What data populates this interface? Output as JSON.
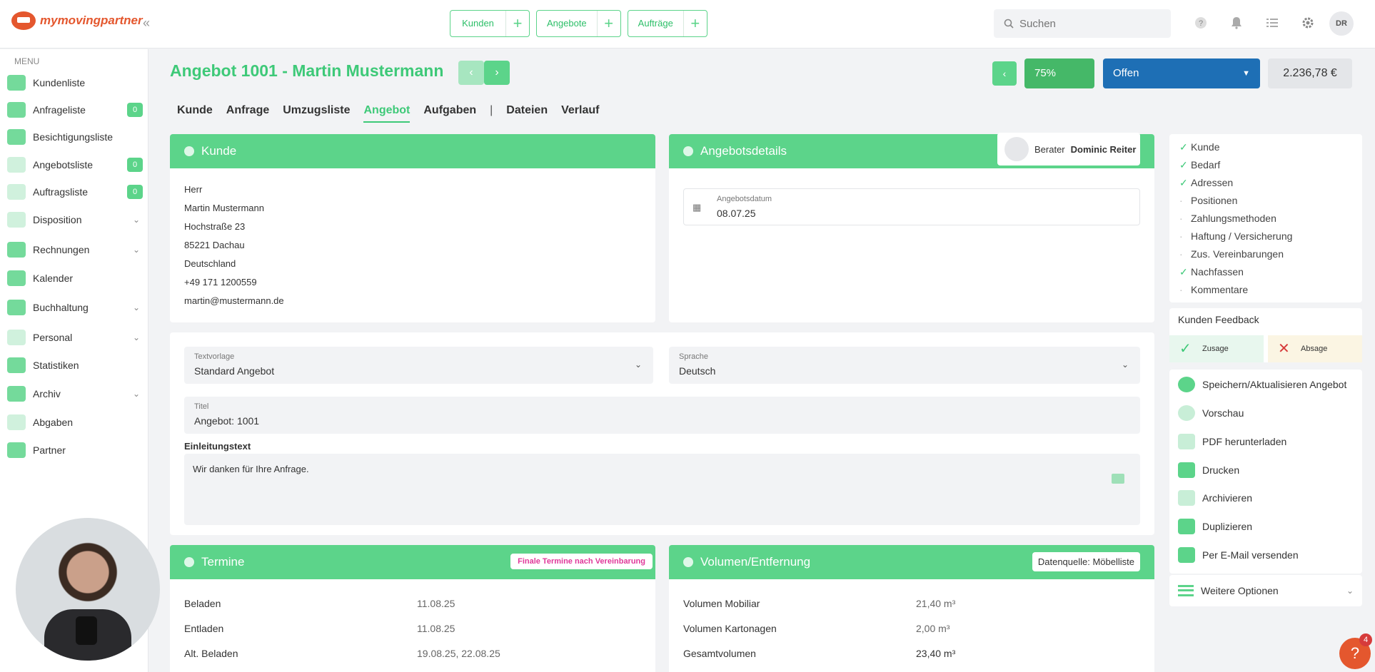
{
  "app": {
    "logo_text": "mymovingpartner",
    "collapse": "«"
  },
  "quick_buttons": [
    {
      "label": "Kunden"
    },
    {
      "label": "Angebote"
    },
    {
      "label": "Aufträge"
    }
  ],
  "quick_add": "+",
  "search": {
    "placeholder": "Suchen"
  },
  "user_initials": "DR",
  "sidebar": {
    "menu_label": "MENU",
    "items": [
      {
        "label": "Kundenliste"
      },
      {
        "label": "Anfrageliste",
        "badge": "0"
      },
      {
        "label": "Besichtigungsliste"
      },
      {
        "label": "Angebotsliste",
        "badge": "0"
      },
      {
        "label": "Auftragsliste",
        "badge": "0"
      },
      {
        "label": "Disposition"
      },
      {
        "label": "Rechnungen"
      },
      {
        "label": "Kalender"
      },
      {
        "label": "Buchhaltung"
      },
      {
        "label": "Personal"
      },
      {
        "label": "Statistiken"
      },
      {
        "label": "Archiv"
      },
      {
        "label": "Abgaben"
      },
      {
        "label": "Partner"
      }
    ]
  },
  "header": {
    "title": "Angebot 1001 - Martin Mustermann",
    "percent": "75%",
    "status": "Offen",
    "total": "2.236,78 €"
  },
  "tabs": [
    "Kunde",
    "Anfrage",
    "Umzugsliste",
    "Angebot",
    "Aufgaben",
    "Dateien",
    "Verlauf"
  ],
  "tab_separator": "|",
  "kunde": {
    "title": "Kunde",
    "lines": [
      "Herr",
      "Martin Mustermann",
      "Hochstraße 23",
      "85221 Dachau",
      "Deutschland",
      "+49 171 1200559",
      "martin@mustermann.de"
    ]
  },
  "angebotsdetails": {
    "title": "Angebotsdetails",
    "berater_label": "Berater",
    "berater_name": "Dominic Reiter",
    "date_label": "Angebotsdatum",
    "date_value": "08.07.25"
  },
  "form": {
    "textvorlage_label": "Textvorlage",
    "textvorlage_value": "Standard Angebot",
    "sprache_label": "Sprache",
    "sprache_value": "Deutsch",
    "titel_label": "Titel",
    "titel_value": "Angebot: 1001",
    "einleitung_label": "Einleitungstext",
    "einleitung_value": "Wir danken für Ihre Anfrage."
  },
  "termine": {
    "title": "Termine",
    "badge": "Finale Termine nach Vereinbarung",
    "rows": [
      {
        "label": "Beladen",
        "value": "11.08.25"
      },
      {
        "label": "Entladen",
        "value": "11.08.25"
      },
      {
        "label": "Alt. Beladen",
        "value": "19.08.25, 22.08.25"
      }
    ]
  },
  "volumen": {
    "title": "Volumen/Entfernung",
    "badge": "Datenquelle: Möbelliste",
    "rows": [
      {
        "label": "Volumen Mobiliar",
        "value": "21,40 m³"
      },
      {
        "label": "Volumen Kartonagen",
        "value": "2,00 m³"
      },
      {
        "label": "Gesamtvolumen",
        "value": "23,40 m³"
      }
    ]
  },
  "checklist": [
    {
      "label": "Kunde",
      "done": true
    },
    {
      "label": "Bedarf",
      "done": true
    },
    {
      "label": "Adressen",
      "done": true
    },
    {
      "label": "Positionen",
      "done": false
    },
    {
      "label": "Zahlungsmethoden",
      "done": false
    },
    {
      "label": "Haftung / Versicherung",
      "done": false
    },
    {
      "label": "Zus. Vereinbarungen",
      "done": false
    },
    {
      "label": "Nachfassen",
      "done": true
    },
    {
      "label": "Kommentare",
      "done": false
    }
  ],
  "feedback": {
    "title": "Kunden Feedback",
    "accept": "Zusage",
    "reject": "Absage"
  },
  "actions": [
    "Speichern/Aktualisieren Angebot",
    "Vorschau",
    "PDF herunterladen",
    "Drucken",
    "Archivieren",
    "Duplizieren",
    "Per E-Mail versenden"
  ],
  "more_options": "Weitere Optionen",
  "help": {
    "label": "?",
    "badge": "4"
  },
  "colors": {
    "accent": "#5cd48a",
    "status_blue": "#1e6fb5",
    "brand": "#e4572e"
  }
}
